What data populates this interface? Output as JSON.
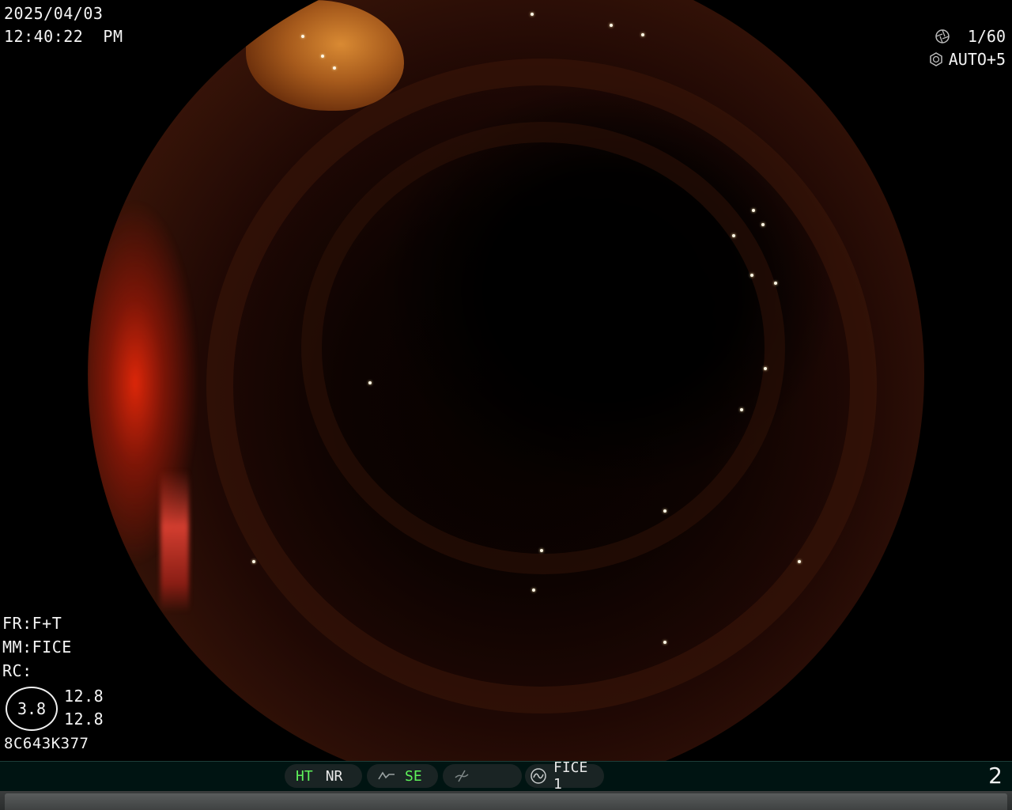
{
  "overlay": {
    "date": "2025/04/03",
    "time": "12:40:22  PM",
    "shutter": "1/60",
    "iris": "AUTO+5",
    "fr": "FR:F+T",
    "mm": "MM:FICE",
    "rc": "RC:",
    "gauge_value": "3.8",
    "gauge_top": "12.8",
    "gauge_bottom": "12.8",
    "scope_id": "8C643K377"
  },
  "status_bar": {
    "ht": "HT",
    "nr": "NR",
    "se": "SE",
    "fice": "FICE 1",
    "page": "2"
  },
  "icons": {
    "shutter": "aperture-icon",
    "iris": "iris-icon",
    "enhance": "enhance-curve-icon",
    "filter": "filter-slash-icon",
    "fice": "fice-wave-icon"
  },
  "colors": {
    "active_mode": "#5ef25a",
    "status_bar_bg": "#001412"
  }
}
